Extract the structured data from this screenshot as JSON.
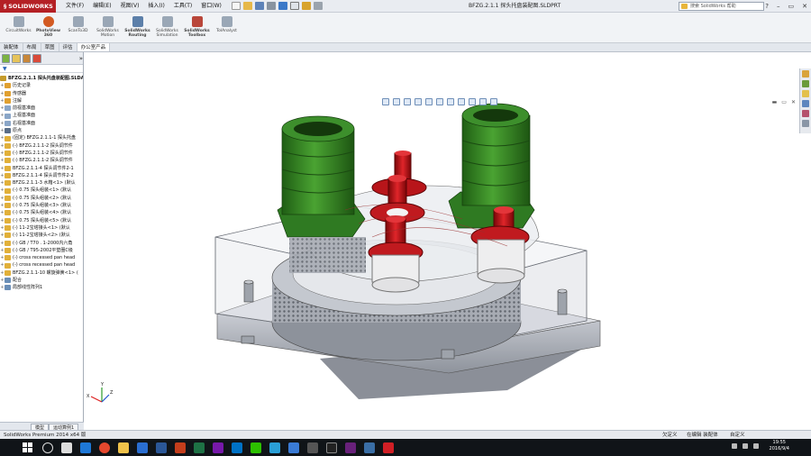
{
  "app": {
    "logo_text": "SOLIDWORKS",
    "document_title": "BFZG.2.1.1 探头托盘装配图.SLDPRT",
    "menus": [
      "文件(F)",
      "编辑(E)",
      "视图(V)",
      "插入(I)",
      "工具(T)",
      "窗口(W)"
    ],
    "search_placeholder": "搜索 SolidWorks 帮助",
    "window_controls": [
      "?",
      "–",
      "▭",
      "✕"
    ]
  },
  "command_manager": [
    {
      "label": "CircuitWorks",
      "color": "#9aa7b6"
    },
    {
      "label": "PhotoView 360",
      "color": "#d25a22"
    },
    {
      "label": "ScanTo3D",
      "color": "#9aa7b6"
    },
    {
      "label": "SolidWorks Motion",
      "color": "#9aa7b6"
    },
    {
      "label": "SolidWorks Routing",
      "color": "#5c7fa9"
    },
    {
      "label": "SolidWorks Simulation",
      "color": "#9aa7b6"
    },
    {
      "label": "SolidWorks Toolbox",
      "color": "#b9463a"
    },
    {
      "label": "TolAnalyst",
      "color": "#9aa7b6"
    }
  ],
  "tabs": [
    "装配体",
    "布局",
    "草图",
    "评估",
    "办公室产品"
  ],
  "active_tab": "办公室产品",
  "tree": [
    {
      "label": "BFZG.2.1.1 探头托盘装配图.SLDASM",
      "icon": "assembly-icon",
      "root": true
    },
    {
      "label": "历史记录",
      "icon": "history-icon",
      "color": "#e0a030"
    },
    {
      "label": "传感器",
      "icon": "sensor-icon",
      "color": "#e0a030"
    },
    {
      "label": "注解",
      "icon": "annotation-icon",
      "color": "#e0a030"
    },
    {
      "label": "前视基准面",
      "icon": "plane-icon",
      "color": "#8aa6c8"
    },
    {
      "label": "上视基准面",
      "icon": "plane-icon",
      "color": "#8aa6c8"
    },
    {
      "label": "右视基准面",
      "icon": "plane-icon",
      "color": "#8aa6c8"
    },
    {
      "label": "原点",
      "icon": "origin-icon",
      "color": "#5a6e88"
    },
    {
      "label": "(固定) BFZG.2.1.1-1 探头托盘",
      "icon": "part-icon",
      "color": "#e1b03a"
    },
    {
      "label": "(-) BFZG.2.1.1-2 探头调节件",
      "icon": "part-icon",
      "color": "#e1b03a"
    },
    {
      "label": "(-) BFZG.2.1.1-2 探头调节件",
      "icon": "part-icon",
      "color": "#e1b03a"
    },
    {
      "label": "(-) BFZG.2.1.1-2 探头调节件",
      "icon": "part-icon",
      "color": "#e1b03a"
    },
    {
      "label": "BFZG.2.1.1-4 探头调节件2-1",
      "icon": "part-icon",
      "color": "#e1b03a"
    },
    {
      "label": "BFZG.2.1.1-4 探头调节件2-2",
      "icon": "part-icon",
      "color": "#e1b03a"
    },
    {
      "label": "BFZG.2.1.1-3 水箱<1> (默认",
      "icon": "part-icon",
      "color": "#e1b03a"
    },
    {
      "label": "(-) 0.75 探头组装<1> (默认",
      "icon": "part-icon",
      "color": "#e1b03a"
    },
    {
      "label": "(-) 0.75 探头组装<2> (默认",
      "icon": "part-icon",
      "color": "#e1b03a"
    },
    {
      "label": "(-) 0.75 探头组装<3> (默认",
      "icon": "part-icon",
      "color": "#e1b03a"
    },
    {
      "label": "(-) 0.75 探头组装<4> (默认",
      "icon": "part-icon",
      "color": "#e1b03a"
    },
    {
      "label": "(-) 0.75 探头组装<5> (默认",
      "icon": "part-icon",
      "color": "#e1b03a"
    },
    {
      "label": "(-) 11-2宝塔接头<1> (默认",
      "icon": "part-icon",
      "color": "#e1b03a"
    },
    {
      "label": "(-) 11-2宝塔接头<2> (默认",
      "icon": "part-icon",
      "color": "#e1b03a"
    },
    {
      "label": "(-) GB / T70 . 1-2000内六角",
      "icon": "part-icon",
      "color": "#e1b03a"
    },
    {
      "label": "(-) GB / T95-2002平垫圈C级",
      "icon": "part-icon",
      "color": "#e1b03a"
    },
    {
      "label": "(-) cross recessed pan head",
      "icon": "part-icon",
      "color": "#e1b03a"
    },
    {
      "label": "(-) cross recessed pan head",
      "icon": "part-icon",
      "color": "#e1b03a"
    },
    {
      "label": "BFZG.2.1.1-10 螺旋弹簧<1> (",
      "icon": "part-icon",
      "color": "#e1b03a"
    },
    {
      "label": "配合",
      "icon": "mates-icon",
      "color": "#6b8fb8"
    },
    {
      "label": "局部线性阵列1",
      "icon": "pattern-icon",
      "color": "#6b8fb8"
    }
  ],
  "bottom_tabs": [
    "模型",
    "运动算例1"
  ],
  "status": {
    "product": "SolidWorks Premium 2014 x64 版",
    "mode": "欠定义",
    "edit": "在编辑 装配体",
    "units": "自定义"
  },
  "taskbar": {
    "time": "19:55",
    "date": "2016/9/4"
  },
  "colors": {
    "green_part": "#3a8a2a",
    "red_part": "#c51418",
    "housing": "#d7d9de"
  }
}
